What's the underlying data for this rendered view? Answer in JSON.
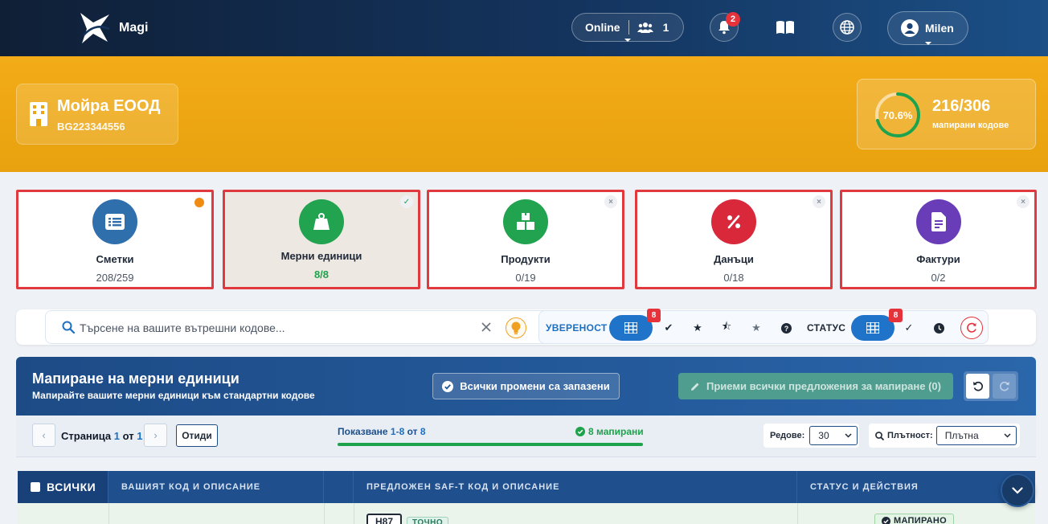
{
  "app": {
    "name": "Magi"
  },
  "nav": {
    "online_label": "Online",
    "online_count": "1",
    "notifications_count": "2",
    "user_name": "Milen"
  },
  "company": {
    "name": "Мойра ЕООД",
    "vat": "BG223344556"
  },
  "progress": {
    "percent_label": "70.6%",
    "percent_value": 0.706,
    "count": "216/306",
    "label": "мапирани кодове"
  },
  "categories": [
    {
      "title": "Сметки",
      "count": "208/259",
      "color": "#2f6fab",
      "icon": "list-icon",
      "state": "pending"
    },
    {
      "title": "Мерни единици",
      "count": "8/8",
      "color": "#22a350",
      "icon": "weight-icon",
      "state": "done"
    },
    {
      "title": "Продукти",
      "count": "0/19",
      "color": "#22a350",
      "icon": "boxes-icon",
      "state": "closed"
    },
    {
      "title": "Данъци",
      "count": "0/18",
      "color": "#d8283a",
      "icon": "percent-icon",
      "state": "closed"
    },
    {
      "title": "Фактури",
      "count": "0/2",
      "color": "#6a3db8",
      "icon": "invoice-icon",
      "state": "closed"
    }
  ],
  "filters": {
    "search_placeholder": "Търсене на вашите вътрешни кодове...",
    "confidence_label": "УВЕРЕНОСТ",
    "confidence_badge": "8",
    "status_label": "СТАТУС",
    "status_badge": "8"
  },
  "panel": {
    "title": "Мапиране на мерни единици",
    "subtitle": "Мапирайте вашите мерни единици към стандартни кодове",
    "saved_label": "Всички промени са запазени",
    "accept_label": "Приеми всички предложения за мапиране (0)"
  },
  "pager": {
    "page_prefix": "Страница",
    "page_current": "1",
    "page_of": "от",
    "page_total": "1",
    "goto_label": "Отиди",
    "showing_prefix": "Показване",
    "showing_range": "1-8",
    "showing_of": "от",
    "showing_total": "8",
    "mapped_label": "8 мапирани",
    "mapped_fraction": 1.0,
    "rows_label": "Редове:",
    "rows_value": "30",
    "density_label": "Плътност:",
    "density_value": "Плътна"
  },
  "table": {
    "col_all": "ВСИЧКИ",
    "col_code": "ВАШИЯТ КОД И ОПИСАНИЕ",
    "col_suggested": "ПРЕДЛОЖЕН SAF-T КОД И ОПИСАНИЕ",
    "col_status": "СТАТУС И ДЕЙСТВИЯ",
    "rows": [
      {
        "code": "H87",
        "match": "ТОЧНО",
        "status": "МАПИРАНО"
      }
    ]
  }
}
